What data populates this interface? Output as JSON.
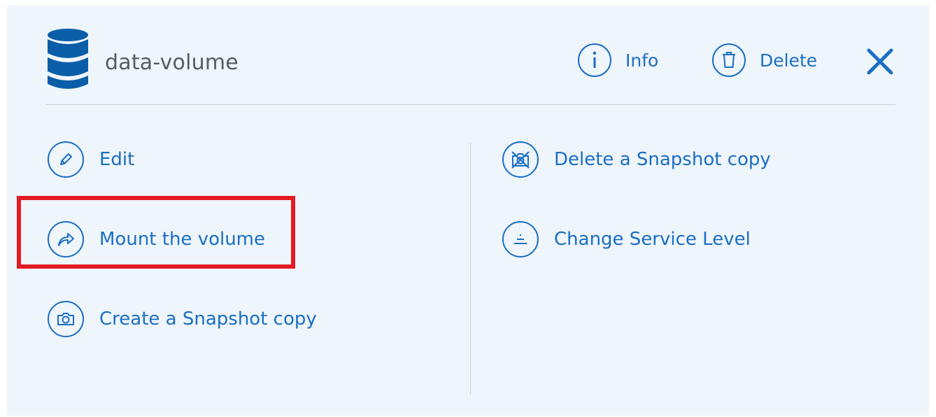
{
  "volume": {
    "name": "data-volume",
    "icon": "database-icon"
  },
  "header_actions": {
    "info_label": "Info",
    "delete_label": "Delete",
    "close_icon": "close-icon"
  },
  "actions_left": [
    {
      "label": "Edit",
      "icon": "pencil-icon"
    },
    {
      "label": "Mount the volume",
      "icon": "share-arrow-icon",
      "highlighted": true
    },
    {
      "label": "Create a Snapshot copy",
      "icon": "camera-icon"
    }
  ],
  "actions_right": [
    {
      "label": "Delete a Snapshot copy",
      "icon": "camera-delete-icon"
    },
    {
      "label": "Change Service Level",
      "icon": "service-level-icon"
    }
  ],
  "colors": {
    "accent": "#1b6ec2",
    "highlight": "#e31b23",
    "background": "#eef5fb"
  }
}
